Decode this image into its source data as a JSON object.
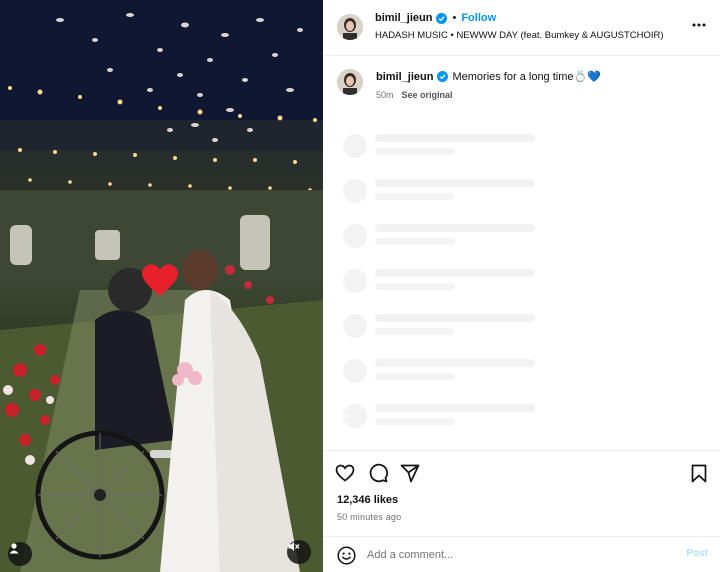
{
  "post": {
    "author": "bimil_jieun",
    "follow_label": "Follow",
    "separator": "•",
    "audio": "HADASH MUSIC • NEWWW DAY (feat. Bumkey & AUGUSTCHOIR)"
  },
  "caption": {
    "author": "bimil_jieun",
    "text": "Memories for a long time",
    "emoji_ring": "💍",
    "emoji_heart": "💙",
    "age": "50m",
    "see_original": "See original"
  },
  "stats": {
    "likes": "12,346 likes",
    "time_ago": "50 minutes ago"
  },
  "comment_box": {
    "placeholder": "Add a comment...",
    "post_label": "Post"
  },
  "icons": {
    "like": "heart-outline-icon",
    "comment": "comment-bubble-icon",
    "share": "paper-plane-icon",
    "save": "bookmark-icon",
    "more": "more-horizontal-icon",
    "tagged": "user-tag-icon",
    "mute": "speaker-muted-icon",
    "emoji": "smiley-icon",
    "verified": "verified-badge-icon"
  },
  "colors": {
    "link_blue": "#0095f6",
    "post_disabled": "#b2dffc",
    "muted_text": "#737373"
  },
  "skeleton_rows": 7
}
